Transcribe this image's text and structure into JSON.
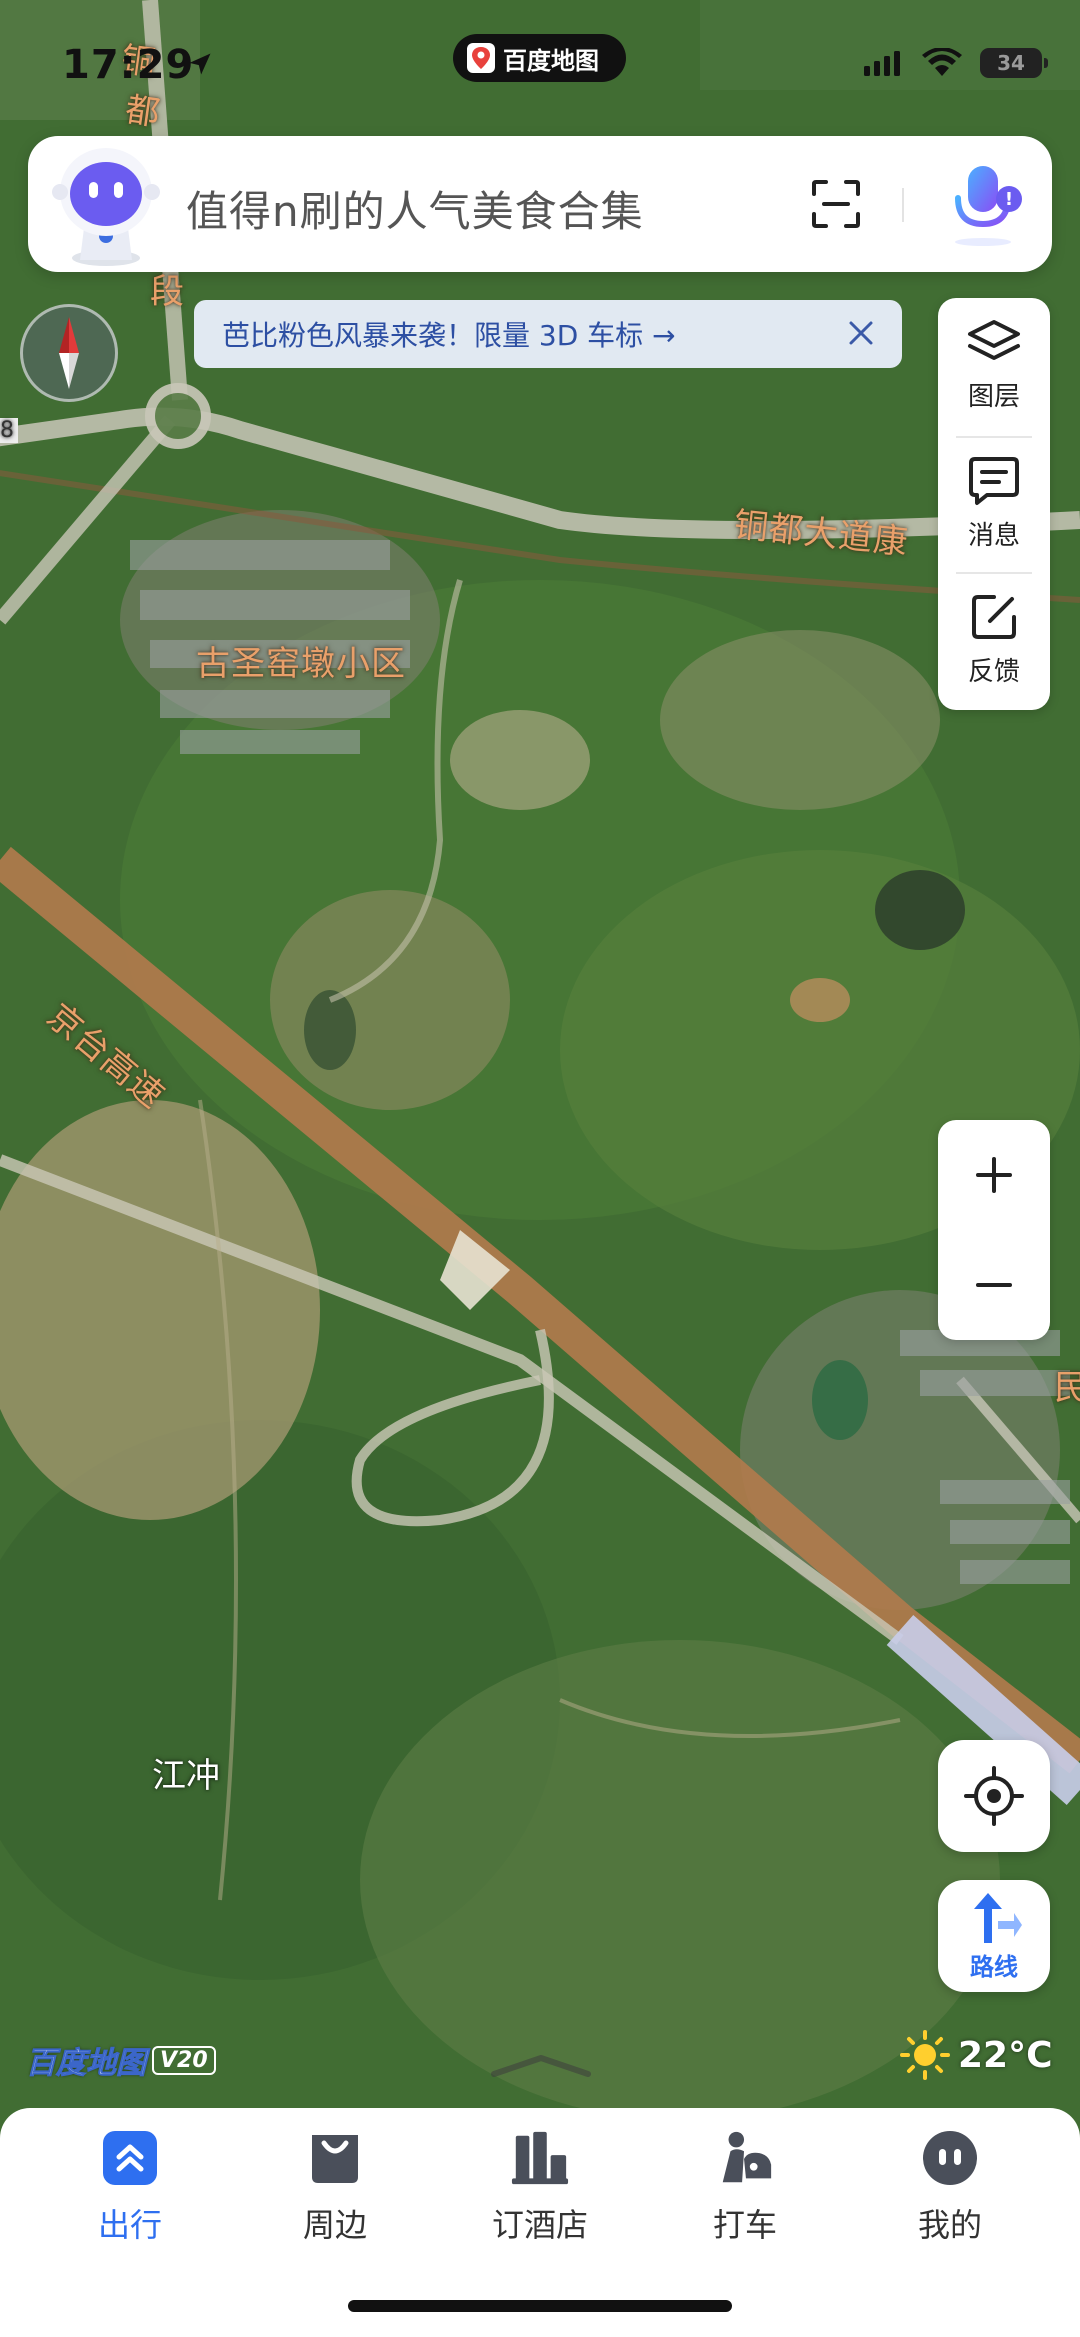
{
  "status_bar": {
    "time": "17:29",
    "app_pill_label": "百度地图",
    "battery": "34"
  },
  "search": {
    "placeholder": "值得n刷的人气美食合集",
    "voice_badge": "!"
  },
  "banner": {
    "text": "芭比粉色风暴来袭！限量 3D 车标 →"
  },
  "tools": {
    "layers_label": "图层",
    "messages_label": "消息",
    "feedback_label": "反馈"
  },
  "zoom": {
    "in_label": "+",
    "out_label": "−"
  },
  "route": {
    "label": "路线"
  },
  "map": {
    "labels": {
      "tongdu": "铜都大道",
      "tongdu_suffix": "康",
      "gusheng": "古圣窑墩小区",
      "jingtai": "京台高速",
      "jiangchong": "江冲",
      "min": "民",
      "top_left_road_1": "铜",
      "top_left_road_2": "都",
      "top_left_road_3": "段",
      "edge_number": "8"
    },
    "logo": "百度地图",
    "logo_version": "V20"
  },
  "weather": {
    "temperature": "22°C"
  },
  "tabs": [
    {
      "label": "出行",
      "icon": "travel-icon",
      "active": true
    },
    {
      "label": "周边",
      "icon": "nearby-icon",
      "active": false
    },
    {
      "label": "订酒店",
      "icon": "hotel-icon",
      "active": false
    },
    {
      "label": "打车",
      "icon": "taxi-icon",
      "active": false
    },
    {
      "label": "我的",
      "icon": "profile-icon",
      "active": false
    }
  ],
  "colors": {
    "accent": "#2e6ff0",
    "map_label": "#e9a06a",
    "voice": "#6b5cf0"
  }
}
